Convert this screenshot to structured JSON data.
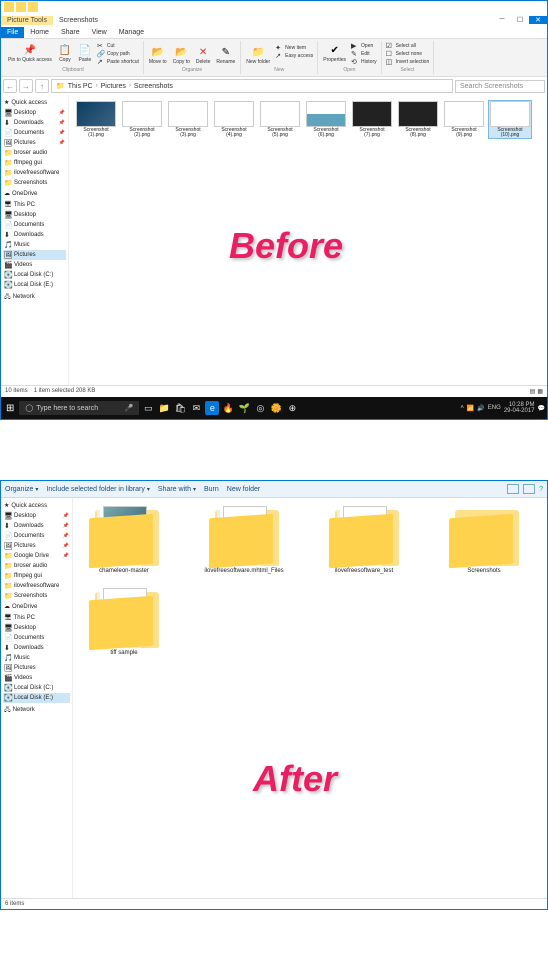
{
  "before_label": "Before",
  "after_label": "After",
  "win1": {
    "titlebar_tab": "Picture Tools",
    "titlebar_title": "Screenshots",
    "menutabs": {
      "file": "File",
      "home": "Home",
      "share": "Share",
      "view": "View",
      "manage": "Manage"
    },
    "ribbon": {
      "pin": "Pin to Quick access",
      "copy": "Copy",
      "paste": "Paste",
      "cut": "Cut",
      "copypath": "Copy path",
      "pasteshortcut": "Paste shortcut",
      "clipboard": "Clipboard",
      "moveto": "Move to",
      "copyto": "Copy to",
      "delete": "Delete",
      "rename": "Rename",
      "organize": "Organize",
      "newfolder": "New folder",
      "newitem": "New item",
      "easyaccess": "Easy access",
      "new": "New",
      "properties": "Properties",
      "open": "Open",
      "edit": "Edit",
      "history": "History",
      "open_g": "Open",
      "selectall": "Select all",
      "selectnone": "Select none",
      "invert": "Invert selection",
      "select": "Select"
    },
    "crumbs": [
      "This PC",
      "Pictures",
      "Screenshots"
    ],
    "search_placeholder": "Search Screenshots",
    "sidebar": {
      "quick": "Quick access",
      "pinned": [
        {
          "icon": "🖥",
          "label": "Desktop"
        },
        {
          "icon": "⬇",
          "label": "Downloads"
        },
        {
          "icon": "📄",
          "label": "Documents"
        },
        {
          "icon": "🖼",
          "label": "Pictures"
        }
      ],
      "recent": [
        "broser audio",
        "ffmpeg gui",
        "ilovefreesoftware",
        "Screenshots"
      ],
      "onedrive": "OneDrive",
      "thispc": "This PC",
      "pcitems": [
        {
          "icon": "🖥",
          "label": "Desktop"
        },
        {
          "icon": "📄",
          "label": "Documents"
        },
        {
          "icon": "⬇",
          "label": "Downloads"
        },
        {
          "icon": "🎵",
          "label": "Music"
        },
        {
          "icon": "🖼",
          "label": "Pictures",
          "sel": true
        },
        {
          "icon": "🎬",
          "label": "Videos"
        },
        {
          "icon": "💽",
          "label": "Local Disk (C:)"
        },
        {
          "icon": "💽",
          "label": "Local Disk (E:)"
        }
      ],
      "network": "Network"
    },
    "thumbs": [
      {
        "cap": "Screenshot (1).png",
        "cls": "desk"
      },
      {
        "cap": "Screenshot (2).png",
        "cls": "white"
      },
      {
        "cap": "Screenshot (3).png",
        "cls": "white"
      },
      {
        "cap": "Screenshot (4).png",
        "cls": "white"
      },
      {
        "cap": "Screenshot (5).png",
        "cls": "white"
      },
      {
        "cap": "Screenshot (6).png",
        "cls": "mix"
      },
      {
        "cap": "Screenshot (7).png",
        "cls": ""
      },
      {
        "cap": "Screenshot (8).png",
        "cls": ""
      },
      {
        "cap": "Screenshot (9).png",
        "cls": "white"
      },
      {
        "cap": "Screenshot (10).png",
        "cls": "white",
        "sel": true
      }
    ],
    "status": {
      "count": "10 items",
      "sel": "1 item selected  208 KB"
    },
    "taskbar": {
      "search": "Type here to search",
      "lang": "ENG",
      "time": "10:28 PM",
      "date": "29-04-2017"
    }
  },
  "win2": {
    "toolbar": {
      "organize": "Organize",
      "include": "Include selected folder in library",
      "share": "Share with",
      "burn": "Burn",
      "newfolder": "New folder"
    },
    "sidebar": {
      "quick": "Quick access",
      "pinned": [
        {
          "icon": "🖥",
          "label": "Desktop"
        },
        {
          "icon": "⬇",
          "label": "Downloads"
        },
        {
          "icon": "📄",
          "label": "Documents"
        },
        {
          "icon": "🖼",
          "label": "Pictures"
        },
        {
          "icon": "📁",
          "label": "Google Drive"
        }
      ],
      "recent": [
        "broser audio",
        "ffmpeg gui",
        "ilovefreesoftware",
        "Screenshots"
      ],
      "onedrive": "OneDrive",
      "thispc": "This PC",
      "pcitems": [
        {
          "icon": "🖥",
          "label": "Desktop"
        },
        {
          "icon": "📄",
          "label": "Documents"
        },
        {
          "icon": "⬇",
          "label": "Downloads"
        },
        {
          "icon": "🎵",
          "label": "Music"
        },
        {
          "icon": "🖼",
          "label": "Pictures"
        },
        {
          "icon": "🎬",
          "label": "Videos"
        },
        {
          "icon": "💽",
          "label": "Local Disk (C:)"
        },
        {
          "icon": "💽",
          "label": "Local Disk (E:)",
          "sel": true
        }
      ],
      "network": "Network"
    },
    "folders": [
      {
        "cap": "chameleon-master",
        "paper": "img"
      },
      {
        "cap": "ilovefreesoftware.mhtml_Files",
        "paper": "ie"
      },
      {
        "cap": "ilovefreesoftware_test",
        "paper": ""
      },
      {
        "cap": "Screenshots",
        "paper": "none"
      },
      {
        "cap": "tiff sample",
        "paper": ""
      }
    ],
    "status": "6 items"
  }
}
